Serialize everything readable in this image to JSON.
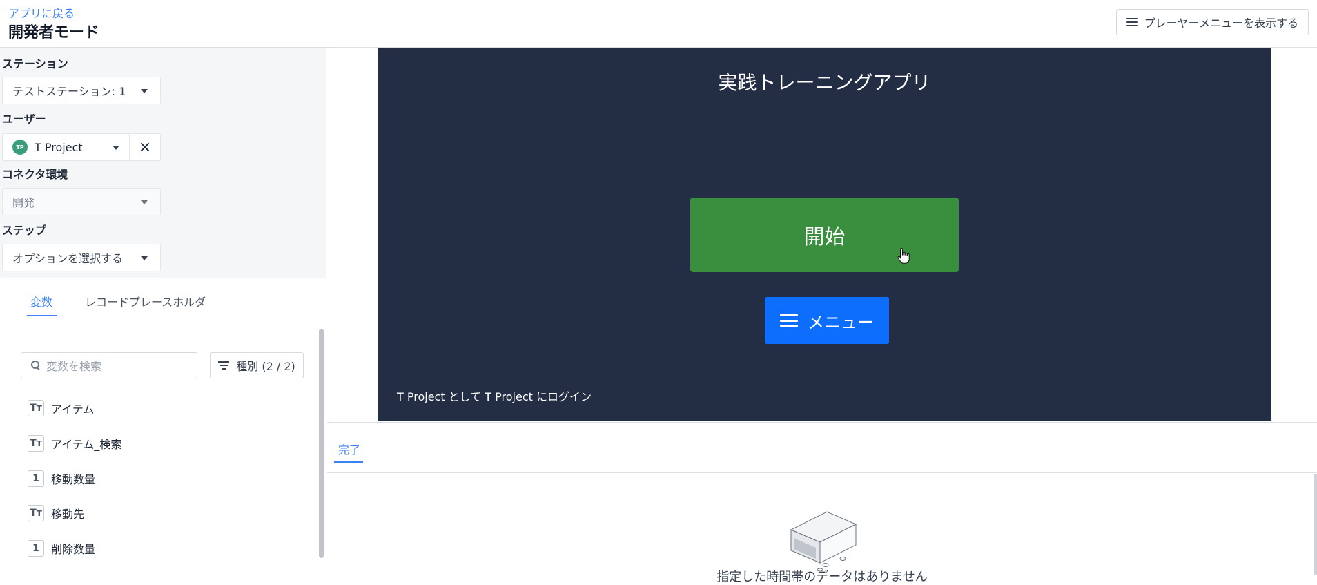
{
  "header": {
    "back_link": "アプリに戻る",
    "title": "開発者モード",
    "player_menu_label": "プレーヤーメニューを表示する"
  },
  "settings": {
    "station": {
      "label": "ステーション",
      "value": "テストステーション: 1"
    },
    "user": {
      "label": "ユーザー",
      "value": "T Project",
      "avatar_initials": "TP"
    },
    "connector": {
      "label": "コネクタ環境",
      "value": "開発"
    },
    "step": {
      "label": "ステップ",
      "value": "オプションを選択する"
    }
  },
  "tabs": {
    "variables": "変数",
    "record_placeholder": "レコードプレースホルダ"
  },
  "search": {
    "placeholder": "変数を検索"
  },
  "filter": {
    "label": "種別 (2 / 2)"
  },
  "variables": [
    {
      "type": "Tт",
      "name": "アイテム"
    },
    {
      "type": "Tт",
      "name": "アイテム_検索"
    },
    {
      "type": "1",
      "name": "移動数量"
    },
    {
      "type": "Tт",
      "name": "移動先"
    },
    {
      "type": "1",
      "name": "削除数量"
    }
  ],
  "preview": {
    "app_title": "実践トレーニングアプリ",
    "start_button": "開始",
    "menu_button": "メニュー",
    "login_text": "T Project として T Project にログイン",
    "background_color": "#232e45",
    "start_color": "#3a8f3f",
    "menu_color": "#0d6efd"
  },
  "bottom": {
    "tab_done": "完了",
    "empty_message": "指定した時間帯のデータはありません"
  }
}
